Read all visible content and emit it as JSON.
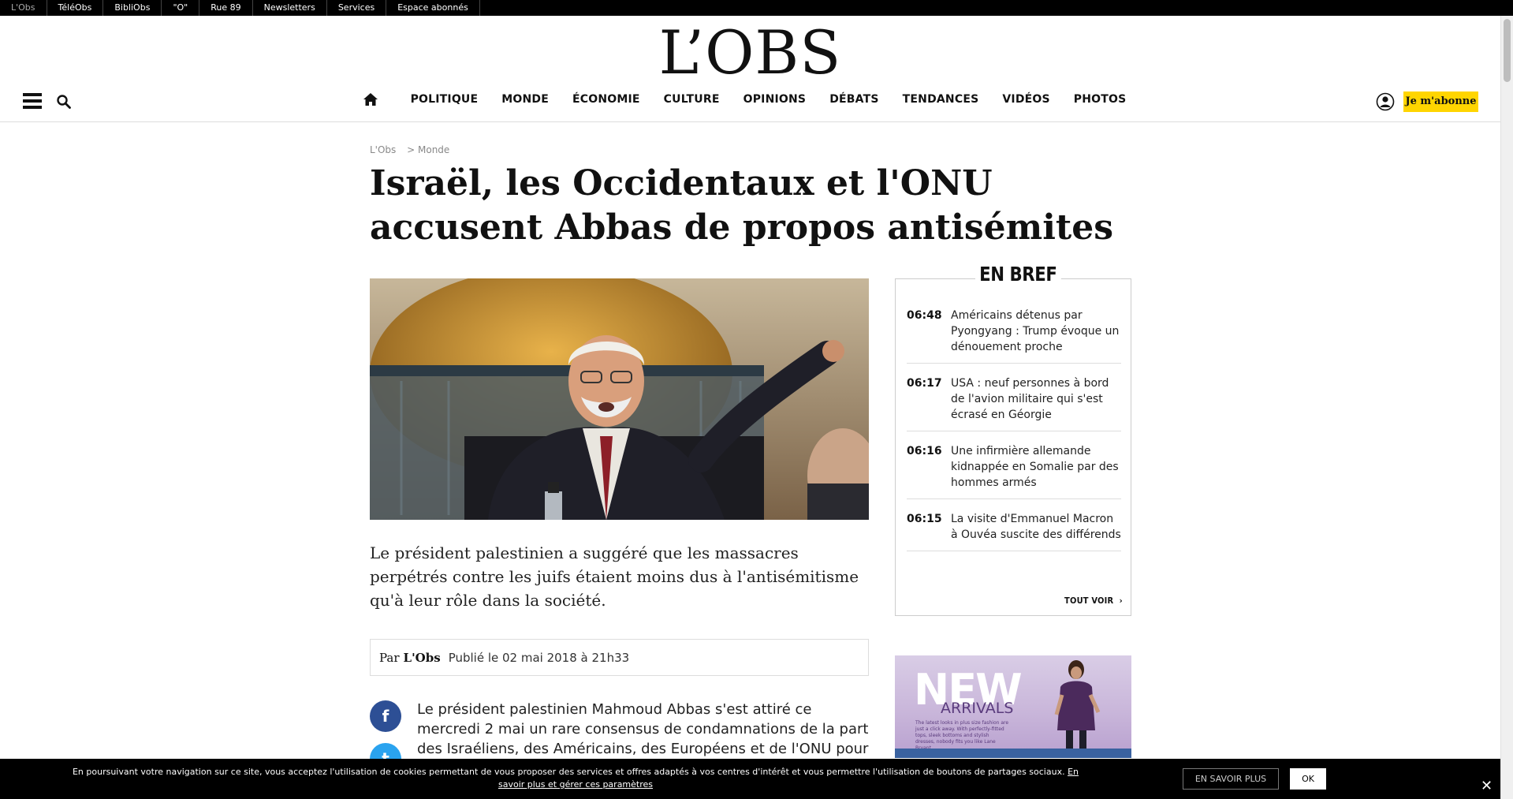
{
  "topbar": {
    "items": [
      "L'Obs",
      "TéléObs",
      "BibliObs",
      "\"O\"",
      "Rue 89",
      "Newsletters",
      "Services",
      "Espace abonnés"
    ]
  },
  "header": {
    "logo": "L’OBS",
    "nav": [
      "POLITIQUE",
      "MONDE",
      "ÉCONOMIE",
      "CULTURE",
      "OPINIONS",
      "DÉBATS",
      "TENDANCES",
      "VIDÉOS",
      "PHOTOS"
    ],
    "subscribe_label": "Je m'abonne"
  },
  "breadcrumb": {
    "home": "L'Obs",
    "section": "> Monde"
  },
  "article": {
    "title": "Israël, les Occidentaux et l'ONU accusent Abbas de propos antisémites",
    "chapo": "Le président palestinien a suggéré que les massacres perpétrés contre les juifs étaient moins dus à l'antisémitisme qu'à leur rôle dans la société.",
    "byline_prefix": "Par",
    "byline_author": "L'Obs",
    "published": "Publié le 02 mai 2018 à 21h33",
    "body": "Le président palestinien Mahmoud Abbas s'est attiré ce mercredi 2 mai un rare consensus de condamnations de la part des Israéliens, des Américains, des Européens et de l'ONU pour"
  },
  "bref": {
    "title": "EN BREF",
    "items": [
      {
        "time": "06:48",
        "text": "Américains détenus par Pyongyang : Trump évoque un dénouement proche"
      },
      {
        "time": "06:17",
        "text": "USA : neuf personnes à bord de l'avion militaire qui s'est écrasé en Géorgie"
      },
      {
        "time": "06:16",
        "text": "Une infirmière allemande kidnappée en Somalie par des hommes armés"
      },
      {
        "time": "06:15",
        "text": "La visite d'Emmanuel Macron à Ouvéa suscite des différends"
      }
    ],
    "see_all": "TOUT VOIR"
  },
  "ad": {
    "headline": "NEW",
    "subline": "ARRIVALS",
    "small": "The latest looks in plus size fashion are just a click away. With perfectly-fitted tops, sleek bottoms and stylish dresses, nobody fits you like Lane Bryant."
  },
  "cookie": {
    "message": "En poursuivant votre navigation sur ce site, vous acceptez l'utilisation de cookies permettant de vous proposer des services et offres adaptés à vos centres d'intérêt et vous permettre l'utilisation de boutons de partages sociaux.",
    "link": "En savoir plus et gérer ces paramètres",
    "more_label": "EN SAVOIR PLUS",
    "ok_label": "OK",
    "close_label": "✕"
  },
  "share": {
    "facebook": "f",
    "twitter": "t"
  }
}
